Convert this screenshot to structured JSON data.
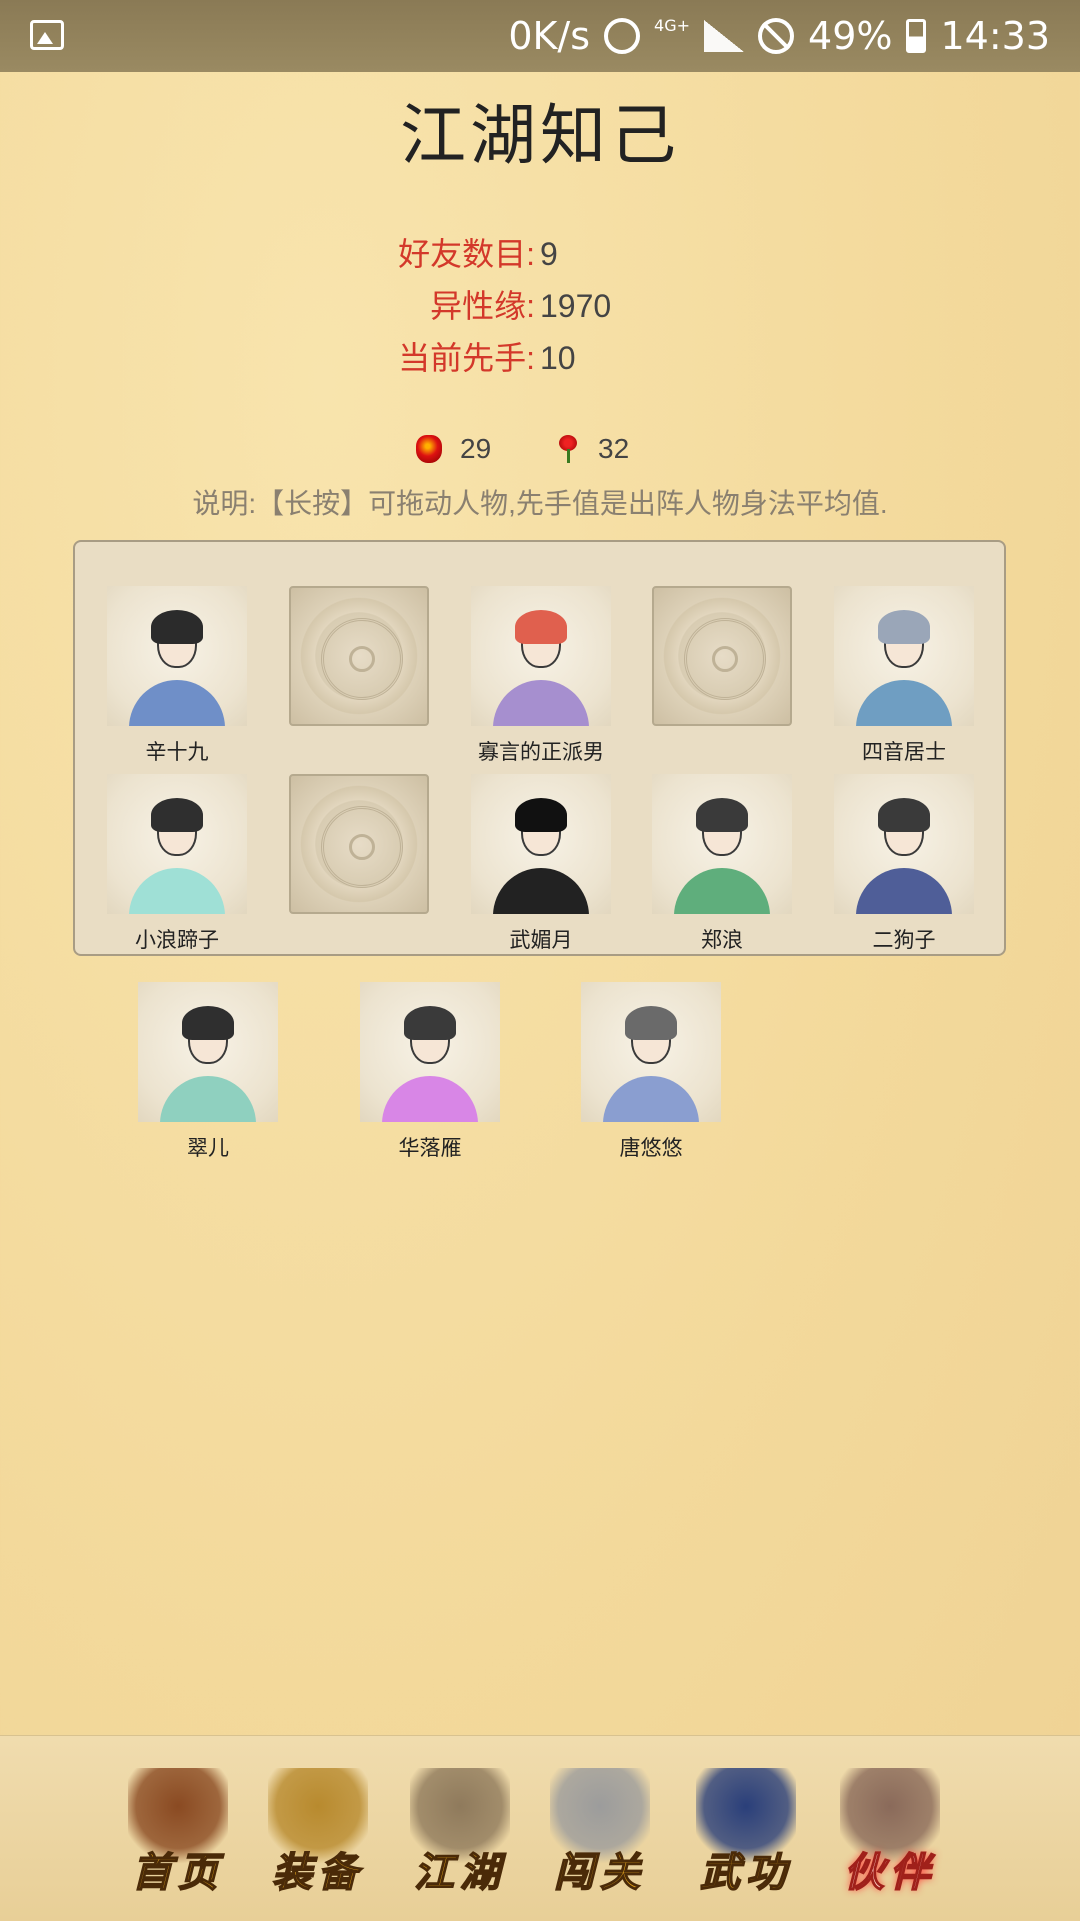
{
  "status_bar": {
    "network_speed": "0K/s",
    "network_type": "4G+",
    "battery": "49%",
    "time": "14:33"
  },
  "page": {
    "title": "江湖知己"
  },
  "stats": [
    {
      "label": "好友数目:",
      "value": "9"
    },
    {
      "label": "异性缘:",
      "value": "1970"
    },
    {
      "label": "当前先手:",
      "value": "10"
    }
  ],
  "currencies": {
    "jar": {
      "icon": "wine-jar-icon",
      "value": "29"
    },
    "rose": {
      "icon": "rose-icon",
      "value": "32"
    }
  },
  "note": "说明:【长按】可拖动人物,先手值是出阵人物身法平均值.",
  "formation": [
    {
      "name": "辛十九",
      "empty": false,
      "hair": "#2b2b2b",
      "robe": "#6f8fc8"
    },
    {
      "name": "",
      "empty": true
    },
    {
      "name": "寡言的正派男",
      "empty": false,
      "hair": "#e0604e",
      "robe": "#a68fcf"
    },
    {
      "name": "",
      "empty": true
    },
    {
      "name": "四音居士",
      "empty": false,
      "hair": "#9aa6b8",
      "robe": "#6f9ec2"
    },
    {
      "name": "小浪蹄子",
      "empty": false,
      "hair": "#2f2f2f",
      "robe": "#9fe0d6"
    },
    {
      "name": "",
      "empty": true
    },
    {
      "name": "武媚月",
      "empty": false,
      "hair": "#111111",
      "robe": "#222222"
    },
    {
      "name": "郑浪",
      "empty": false,
      "hair": "#3a3a3a",
      "robe": "#5fae7c"
    },
    {
      "name": "二狗子",
      "empty": false,
      "hair": "#3a3a3a",
      "robe": "#4f5e98"
    }
  ],
  "bench": [
    {
      "name": "翠儿",
      "hair": "#2f2f2f",
      "robe": "#8fd0bf"
    },
    {
      "name": "华落雁",
      "hair": "#3a3a3a",
      "robe": "#d886e6"
    },
    {
      "name": "唐悠悠",
      "hair": "#6a6a6a",
      "robe": "#8a9ed0"
    }
  ],
  "tabs": [
    {
      "label": "首页",
      "icon": "house-icon",
      "active": false,
      "color": "#8a4a22"
    },
    {
      "label": "装备",
      "icon": "armor-icon",
      "active": false,
      "color": "#b88a2e"
    },
    {
      "label": "江湖",
      "icon": "scroll-map-icon",
      "active": false,
      "color": "#8f7a5c"
    },
    {
      "label": "闯关",
      "icon": "crossed-swords-icon",
      "active": false,
      "color": "#9c9c9c"
    },
    {
      "label": "武功",
      "icon": "book-icon",
      "active": false,
      "color": "#2a3f7a"
    },
    {
      "label": "伙伴",
      "icon": "partners-icon",
      "active": true,
      "color": "#8a6a5a"
    }
  ]
}
